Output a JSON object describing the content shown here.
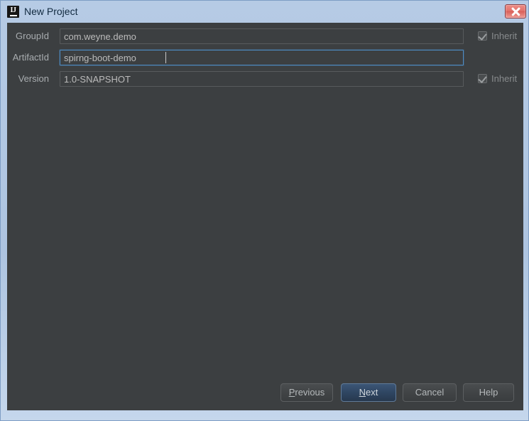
{
  "window": {
    "title": "New Project",
    "icon": "intellij-idea-logo-icon",
    "close_label": "x",
    "accent_blue": "#4e8bc4",
    "panel_bg": "#3c3f41",
    "frame_bg": "#b6cbe5",
    "default_button_bg": "#2f4662"
  },
  "form": {
    "fields": [
      {
        "label": "GroupId",
        "value": "com.weyne.demo",
        "placeholder": "GroupId",
        "focused": false,
        "inherit": {
          "label": "Inherit",
          "checked": true,
          "enabled": false
        }
      },
      {
        "label": "ArtifactId",
        "value": "spirng-boot-demo",
        "placeholder": "ArtifactId",
        "focused": true,
        "inherit": null
      },
      {
        "label": "Version",
        "value": "1.0-SNAPSHOT",
        "placeholder": "Version",
        "focused": false,
        "inherit": {
          "label": "Inherit",
          "checked": true,
          "enabled": false
        }
      }
    ]
  },
  "buttons": {
    "previous": {
      "label": "Previous",
      "mnemonic": "P",
      "default": false
    },
    "next": {
      "label": "Next",
      "mnemonic": "N",
      "default": true
    },
    "cancel": {
      "label": "Cancel",
      "mnemonic": "",
      "default": false
    },
    "help": {
      "label": "Help",
      "mnemonic": "",
      "default": false
    }
  }
}
